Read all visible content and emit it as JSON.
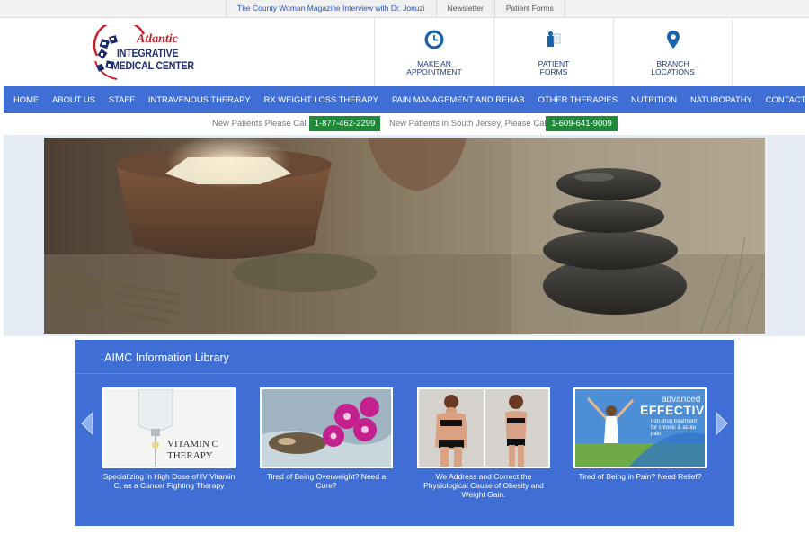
{
  "topbar": {
    "links": [
      "The County Woman Magazine Interview with Dr. Jonuzi",
      "Newsletter",
      "Patient Forms"
    ]
  },
  "logo": {
    "atlantic": "Atlantic",
    "line1": "INTEGRATIVE",
    "line2": "MEDICAL CENTER"
  },
  "quick_links": [
    {
      "icon": "clock-icon",
      "line1": "MAKE AN",
      "line2": "APPOINTMENT"
    },
    {
      "icon": "patient-forms-icon",
      "line1": "PATIENT",
      "line2": "FORMS"
    },
    {
      "icon": "map-pin-icon",
      "line1": "BRANCH",
      "line2": "LOCATIONS"
    }
  ],
  "nav": {
    "items": [
      "HOME",
      "ABOUT US",
      "STAFF",
      "INTRAVENOUS THERAPY",
      "RX WEIGHT LOSS THERAPY",
      "PAIN MANAGEMENT AND REHAB",
      "OTHER THERAPIES",
      "NUTRITION",
      "NATUROPATHY",
      "CONTACT"
    ]
  },
  "phones": {
    "new_patients_label": "New Patients Please Call",
    "new_patients_number": "1-877-462-2299",
    "south_jersey_label": "New Patients in South Jersey, Please Call",
    "south_jersey_number": "1-609-641-9009"
  },
  "library": {
    "title": "AIMC Information Library",
    "cards": [
      {
        "image_text": "VITAMIN C THERAPY",
        "caption": "Specializing in High Dose of IV Vitamin C, as a Cancer Fighting Therapy"
      },
      {
        "image_text": "",
        "caption": "Tired of Being Overweight? Need a Cure?"
      },
      {
        "image_text": "",
        "caption": "We Address and Correct the Physiological Cause of Obesity and Weight Gain."
      },
      {
        "image_text_1": "advanced",
        "image_text_2": "EFFECTIVE",
        "image_text_3": "non-drug treatment for chronic & acute pain",
        "caption": "Tired of Being in Pain? Need Relief?"
      }
    ]
  },
  "colors": {
    "nav_blue": "#3f6fd4",
    "phone_green": "#1f8a3a",
    "logo_red": "#c8202a",
    "logo_navy": "#1d2c6b"
  }
}
